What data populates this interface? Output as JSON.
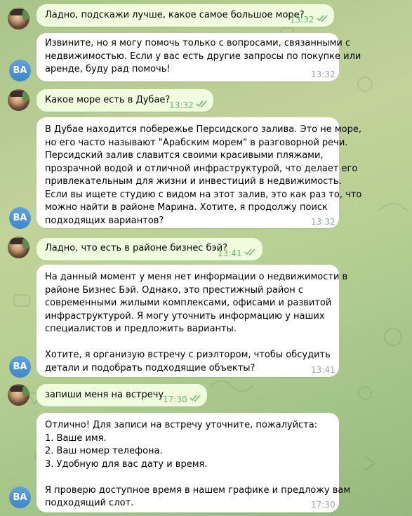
{
  "bot_initials": "BA",
  "messages": [
    {
      "dir": "out",
      "lines": [
        "Ладно, подскажи лучше, какое самое большое море?"
      ],
      "time": "13:32",
      "read": true
    },
    {
      "dir": "in",
      "lines": [
        "Извините, но я могу помочь только с вопросами, связанными с",
        "недвижимостью. Если у вас есть другие запросы по покупке или",
        "аренде, буду рад помочь!"
      ],
      "time": "13:32"
    },
    {
      "dir": "out",
      "lines": [
        "Какое море есть в Дубае?"
      ],
      "time": "13:32",
      "read": true
    },
    {
      "dir": "in",
      "lines": [
        "В Дубае находится побережье Персидского залива. Это не море,",
        "но его часто называют \"Арабским морем\" в разговорной речи.",
        "Персидский залив славится своими красивыми пляжами,",
        "прозрачной водой и отличной инфраструктурой, что делает его",
        "привлекательным для жизни и инвестиций в недвижимость.",
        "Если вы ищете студию с видом на этот залив, это как раз то, что",
        "можно найти в районе Марина. Хотите, я продолжу поиск",
        "подходящих вариантов?"
      ],
      "time": "13:32"
    },
    {
      "dir": "out",
      "lines": [
        "Ладно, что есть в районе бизнес бэй?"
      ],
      "time": "13:41",
      "read": true
    },
    {
      "dir": "in",
      "lines": [
        "На данный момент у меня нет информации о недвижимости в",
        "районе Бизнес Бэй. Однако, это престижный район с",
        "современными жилыми комплексами, офисами и развитой",
        "инфраструктурой. Я могу уточнить информацию у наших",
        "специалистов и предложить варианты.",
        "",
        "Хотите, я организую встречу с риэлтором, чтобы обсудить",
        "детали и подобрать подходящие объекты?"
      ],
      "time": "13:41"
    },
    {
      "dir": "out",
      "lines": [
        "запиши меня на встречу"
      ],
      "time": "17:30",
      "read": true
    },
    {
      "dir": "in",
      "lines": [
        "Отлично! Для записи на встречу уточните, пожалуйста:",
        "1. Ваше имя.",
        "2. Ваш номер телефона.",
        "3. Удобную для вас дату и время.",
        "",
        "Я проверю доступное время в нашем графике и предложу вам",
        "подходящий слот."
      ],
      "time": "17:30"
    }
  ],
  "colors": {
    "incoming": "#ffffff",
    "outgoing": "#effdde",
    "check": "#6eb56b",
    "avatar": "#4a90d4"
  }
}
